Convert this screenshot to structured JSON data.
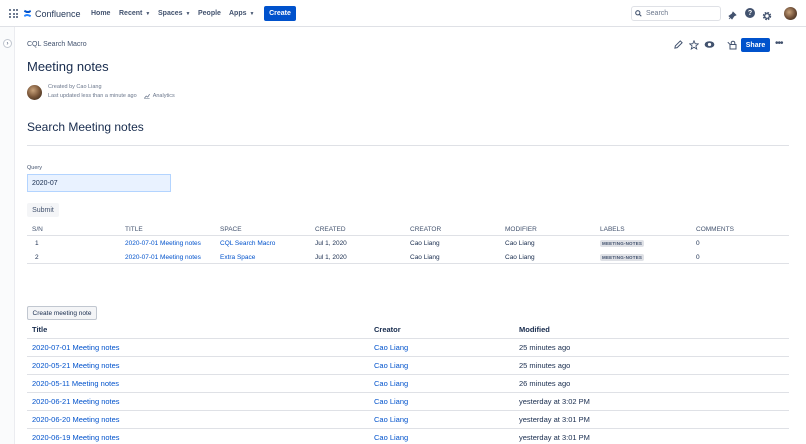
{
  "topnav": {
    "product": "Confluence",
    "items": [
      "Home",
      "Recent",
      "Spaces",
      "People",
      "Apps"
    ],
    "create_label": "Create",
    "search_placeholder": "Search",
    "help_glyph": "?",
    "icons": [
      "app-switcher-icon",
      "confluence-logo-icon",
      "search-icon",
      "notifications-icon",
      "help-icon",
      "settings-icon",
      "avatar"
    ]
  },
  "sidebar": {
    "toggle_glyph": "›"
  },
  "page": {
    "breadcrumb": "CQL Search Macro",
    "share_label": "Share",
    "more_glyph": "•••",
    "title": "Meeting notes",
    "created_by": "Created by Cao Liang",
    "last_updated": "Last updated less than a minute ago",
    "analytics_label": "Analytics"
  },
  "search_section": {
    "heading": "Search Meeting notes",
    "query_label": "Query",
    "query_value": "2020-07",
    "submit_label": "Submit"
  },
  "results": {
    "columns": [
      "S/N",
      "TITLE",
      "SPACE",
      "CREATED",
      "CREATOR",
      "MODIFIER",
      "LABELS",
      "COMMENTS"
    ],
    "rows": [
      {
        "sn": "1",
        "title": "2020-07-01 Meeting notes",
        "space": "CQL Search Macro",
        "created": "Jul 1, 2020",
        "creator": "Cao Liang",
        "modifier": "Cao Liang",
        "label": "MEETING-NOTES",
        "comments": "0"
      },
      {
        "sn": "2",
        "title": "2020-07-01 Meeting notes",
        "space": "Extra Space",
        "created": "Jul 1, 2020",
        "creator": "Cao Liang",
        "modifier": "Cao Liang",
        "label": "MEETING-NOTES",
        "comments": "0"
      }
    ]
  },
  "meeting_notes": {
    "create_label": "Create meeting note",
    "columns": [
      "Title",
      "Creator",
      "Modified"
    ],
    "rows": [
      {
        "title": "2020-07-01 Meeting notes",
        "creator": "Cao Liang",
        "modified": "25 minutes ago"
      },
      {
        "title": "2020-05-21 Meeting notes",
        "creator": "Cao Liang",
        "modified": "25 minutes ago"
      },
      {
        "title": "2020-05-11 Meeting notes",
        "creator": "Cao Liang",
        "modified": "26 minutes ago"
      },
      {
        "title": "2020-06-21 Meeting notes",
        "creator": "Cao Liang",
        "modified": "yesterday at 3:02 PM"
      },
      {
        "title": "2020-06-20 Meeting notes",
        "creator": "Cao Liang",
        "modified": "yesterday at 3:01 PM"
      },
      {
        "title": "2020-06-19 Meeting notes",
        "creator": "Cao Liang",
        "modified": "yesterday at 3:01 PM"
      }
    ]
  },
  "colors": {
    "primary": "#0052cc",
    "text": "#172b4d",
    "subtle": "#6b778c",
    "border": "#dfe1e6"
  }
}
